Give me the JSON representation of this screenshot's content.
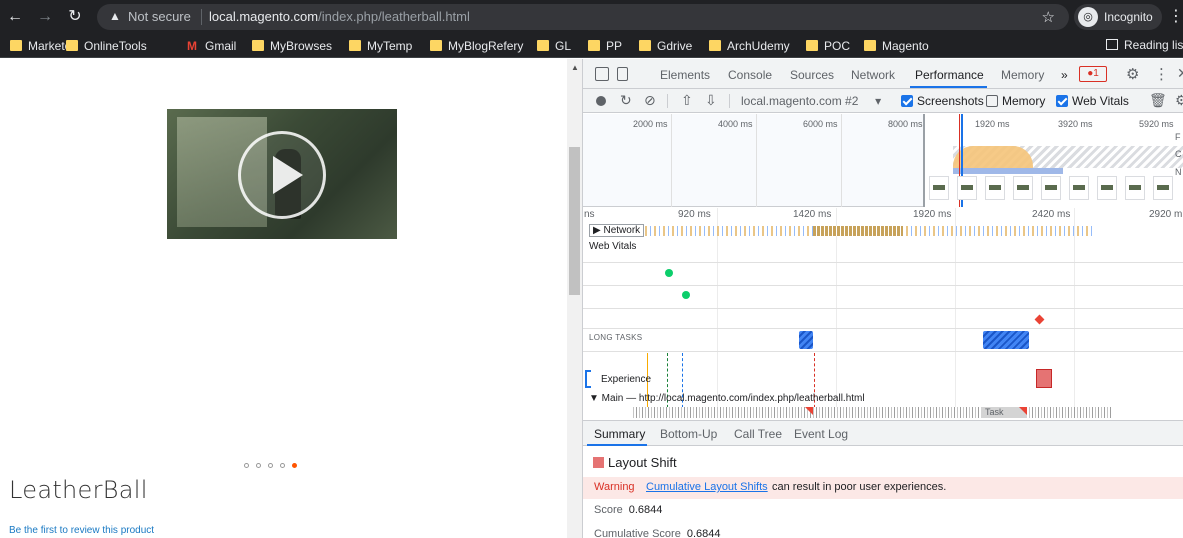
{
  "browser": {
    "omnibox": {
      "security_label": "Not secure",
      "host": "local.magento.com",
      "path": "/index.php/leatherball.html"
    },
    "profile_label": "Incognito",
    "icons": [
      "back-arrow-icon",
      "forward-arrow-icon",
      "reload-icon",
      "warning-triangle-icon",
      "star-icon",
      "incognito-icon",
      "kebab-menu-icon"
    ]
  },
  "bookmarks": {
    "items": [
      {
        "label": "Marketo",
        "icon": "folder-icon"
      },
      {
        "label": "OnlineTools",
        "icon": "folder-icon"
      },
      {
        "label": "Gmail",
        "icon": "gmail-icon"
      },
      {
        "label": "MyBrowses",
        "icon": "folder-icon"
      },
      {
        "label": "MyTemp",
        "icon": "folder-icon"
      },
      {
        "label": "MyBlogRefery",
        "icon": "folder-icon"
      },
      {
        "label": "GL",
        "icon": "folder-icon"
      },
      {
        "label": "PP",
        "icon": "folder-icon"
      },
      {
        "label": "Gdrive",
        "icon": "folder-icon"
      },
      {
        "label": "ArchUdemy",
        "icon": "folder-icon"
      },
      {
        "label": "POC",
        "icon": "folder-icon"
      },
      {
        "label": "Magento",
        "icon": "folder-icon"
      }
    ],
    "reading_list": "Reading lis"
  },
  "page": {
    "product_title": "LeatherBall",
    "review_link": "Be the first to review this product",
    "gallery_dots": {
      "count": 5,
      "active_index": 4
    },
    "accent_color": "#ff5501"
  },
  "devtools": {
    "tabs": [
      "Elements",
      "Console",
      "Sources",
      "Network",
      "Performance",
      "Memory"
    ],
    "active_tab": "Performance",
    "more_tabs": "»",
    "error_count": "1",
    "toolbar": {
      "profile": "local.magento.com #2",
      "checkboxes": [
        {
          "label": "Screenshots",
          "checked": true
        },
        {
          "label": "Memory",
          "checked": false
        },
        {
          "label": "Web Vitals",
          "checked": true
        }
      ]
    },
    "overview": {
      "ticks": [
        "2000 ms",
        "4000 ms",
        "6000 ms",
        "8000 ms",
        "1920 ms",
        "3920 ms",
        "5920 ms"
      ],
      "side_labels": [
        "F",
        "C",
        "N"
      ]
    },
    "timeline": {
      "ruler": [
        "ns",
        "920 ms",
        "1420 ms",
        "1920 ms",
        "2420 ms",
        "2920 m"
      ],
      "network_label": "▶ Network",
      "web_vitals_label": "Web Vitals",
      "long_tasks_label": "LONG TASKS",
      "experience_label": "Experience",
      "main_label": "▼ Main — http://local.magento.com/index.php/leatherball.html",
      "task_label": "Task"
    },
    "bottom_panel": {
      "tabs": [
        "Summary",
        "Bottom-Up",
        "Call Tree",
        "Event Log"
      ],
      "active_tab": "Summary",
      "title": "Layout Shift",
      "warning_label": "Warning",
      "warning_link": "Cumulative Layout Shifts",
      "warning_text": "can result in poor user experiences.",
      "score_label": "Score",
      "score_value": "0.6844",
      "cumulative_label": "Cumulative Score",
      "cumulative_value": "0.6844"
    }
  }
}
